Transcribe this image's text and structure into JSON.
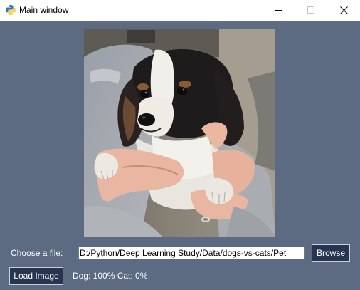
{
  "window": {
    "title": "Main window",
    "icon": "python-icon",
    "controls": [
      "minimize-icon",
      "maximize-icon",
      "close-icon"
    ]
  },
  "colors": {
    "background": "#5c6b82",
    "button": "#283550",
    "button_text": "#ffffff",
    "label_text": "#ffffff"
  },
  "image": {
    "subject": "puppy held in hands",
    "icon": "photo-preview"
  },
  "file_chooser": {
    "label": "Choose a file:",
    "path_value": "D:/Python/Deep Learning Study/Data/dogs-vs-cats/Pet",
    "browse_label": "Browse"
  },
  "actions": {
    "load_label": "Load Image",
    "result_text": "Dog: 100% Cat: 0%"
  }
}
